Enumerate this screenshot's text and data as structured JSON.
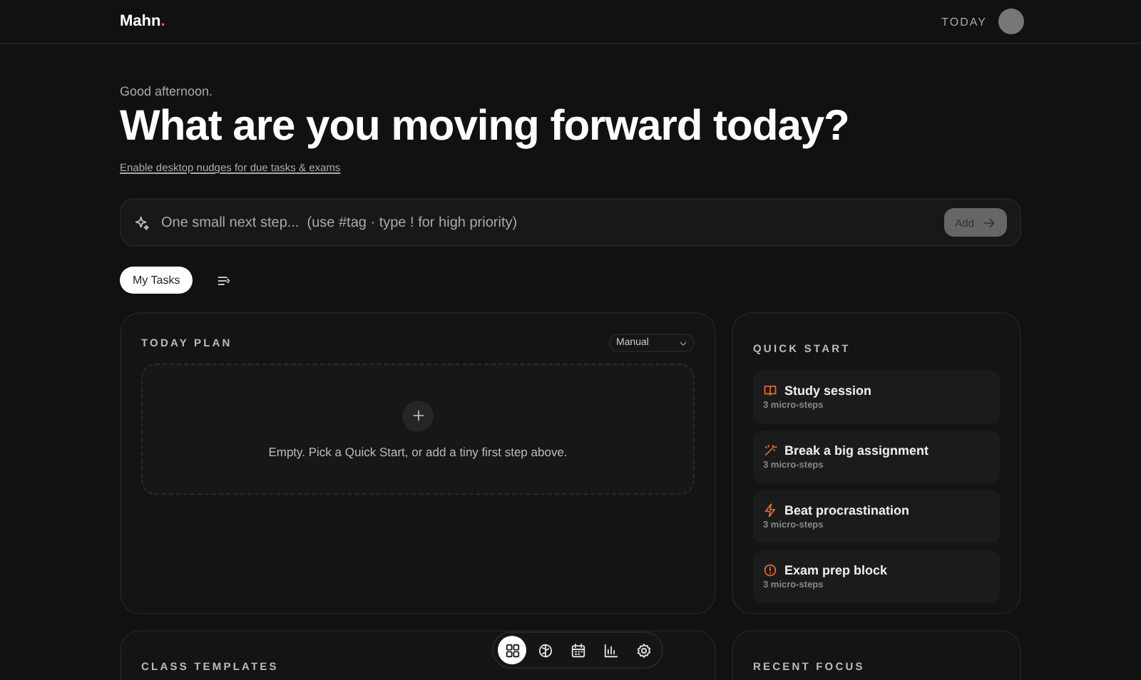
{
  "header": {
    "logo": "Mahn",
    "logo_dot": ".",
    "today": "TODAY"
  },
  "greeting": "Good afternoon.",
  "heading": "What are you moving forward today?",
  "nudge_link": "Enable desktop nudges for due tasks & exams",
  "task_input": {
    "placeholder": "One small next step...  (use #tag · type ! for high priority)",
    "button": "Add"
  },
  "tabs": [
    {
      "kind": "text",
      "label": "My Tasks",
      "selected": true
    },
    {
      "kind": "icon",
      "selected": false
    }
  ],
  "today_plan": {
    "title": "TODAY PLAN",
    "sort": "Manual",
    "empty": "Empty. Pick a Quick Start, or add a tiny first step above."
  },
  "quick_start": {
    "title": "QUICK START",
    "items": [
      {
        "title": "Study session",
        "subtitle": "3 micro-steps"
      },
      {
        "title": "Break a big assignment",
        "subtitle": "3 micro-steps"
      },
      {
        "title": "Beat procrastination",
        "subtitle": "3 micro-steps"
      },
      {
        "title": "Exam prep block",
        "subtitle": "3 micro-steps"
      }
    ]
  },
  "class_templates": {
    "title": "CLASS TEMPLATES"
  },
  "recent_focus": {
    "title": "RECENT FOCUS"
  },
  "nav": [
    {
      "selected": true
    },
    {
      "selected": false
    },
    {
      "selected": false
    },
    {
      "selected": false
    },
    {
      "selected": false
    }
  ]
}
